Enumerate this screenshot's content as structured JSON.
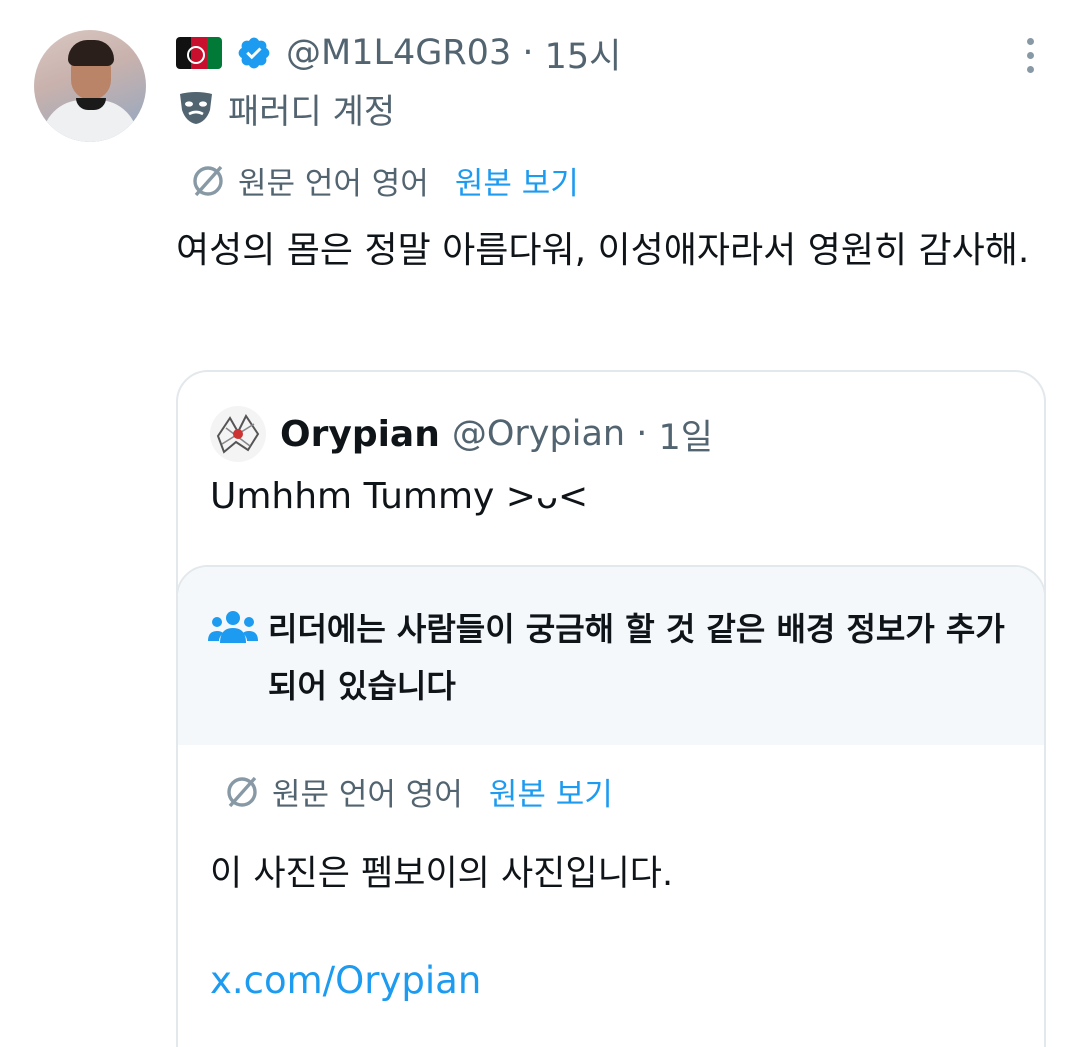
{
  "author": {
    "handle": "@M1L4GR03",
    "time": "15시",
    "parody_label": "패러디 계정",
    "icons": [
      "afghanistan-flag-icon",
      "verified-badge-icon",
      "theater-mask-icon",
      "more-vertical-icon"
    ]
  },
  "translation": {
    "lang_label": "원문 언어 영어",
    "show_original": "원본 보기"
  },
  "tweet": {
    "text": "여성의 몸은 정말 아름다워, 이성애자라서 영원히 감사해."
  },
  "quote": {
    "name": "Orypian",
    "handle": "@Orypian",
    "time": "1일",
    "text": "Umhhm Tummy >ᴗ<"
  },
  "community_note": {
    "title": "리더에는 사람들이 궁금해 할 것 같은 배경 정보가 추가되어 있습니다",
    "translation_lang_label": "원문 언어 영어",
    "translation_show_original": "원본 보기",
    "text": "이 사진은 펨보이의 사진입니다.",
    "link": "x.com/Orypian"
  },
  "colors": {
    "accent": "#1d9bf0",
    "secondary_text": "#536471",
    "text": "#0f1419",
    "border": "#e2e8ec",
    "note_bg": "#f5f8fa"
  }
}
